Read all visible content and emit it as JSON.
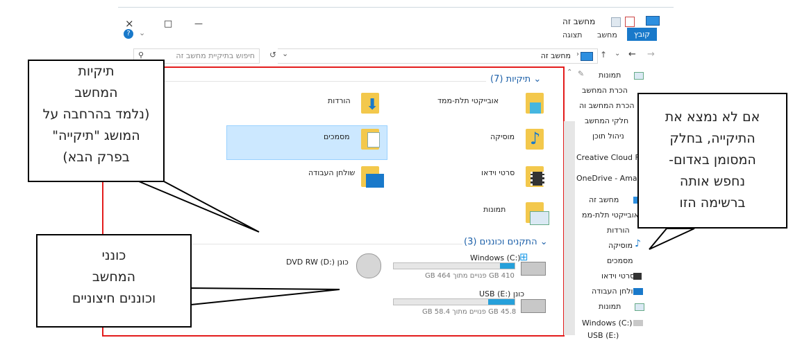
{
  "titlebar": {
    "title": "מחשב זה",
    "controls": {
      "close": "×",
      "maximize": "□",
      "minimize": "—"
    }
  },
  "ribbon": {
    "tabs": [
      "קובץ",
      "מחשב",
      "תצוגה"
    ]
  },
  "address": {
    "path": "מחשב זה",
    "search_placeholder": "חיפוש בתיקיית מחשב זה",
    "back": "←",
    "forward": "→",
    "up": "↑",
    "recent": "⌄",
    "refresh": "↺"
  },
  "folders": {
    "header": "תיקיות (7)",
    "items": [
      {
        "label": "אובייקטי תלת-ממד"
      },
      {
        "label": "הורדות"
      },
      {
        "label": "מוסיקה"
      },
      {
        "label": "מסמכים"
      },
      {
        "label": "סרטי וידאו"
      },
      {
        "label": "שולחן העבודה"
      },
      {
        "label": "תמונות"
      }
    ]
  },
  "drives": {
    "header": "התקנים וכוננים (3)",
    "items": [
      {
        "label": "Windows (C:)",
        "free": "410 GB פנויים מתוך 464 GB",
        "used_fraction": 0.12
      },
      {
        "label": "כונן DVD RW (D:)"
      },
      {
        "label": "כונן USB (E:)",
        "free": "45.8 GB פנויים מתוך 58.4 GB",
        "used_fraction": 0.22
      }
    ]
  },
  "nav_pane": {
    "items": [
      {
        "label": "תמונות"
      },
      {
        "label": "הכרת המחשב"
      },
      {
        "label": "הכרת המחשב וה"
      },
      {
        "label": "חלקי המחשב"
      },
      {
        "label": "ניהול תוכן"
      },
      {
        "label": "Creative Cloud Files"
      },
      {
        "label": "OneDrive - Amanet"
      },
      {
        "label": "מחשב זה"
      },
      {
        "label": "אובייקטי תלת-ממ"
      },
      {
        "label": "הורדות"
      },
      {
        "label": "מוסיקה"
      },
      {
        "label": "מסמכים"
      },
      {
        "label": "סרטי וידאו"
      },
      {
        "label": "שולחן העבודה"
      },
      {
        "label": "תמונות"
      },
      {
        "label": "Windows (C:)"
      },
      {
        "label": "USB (E:)"
      }
    ]
  },
  "callouts": {
    "folders_note": [
      "תיקיות",
      "המחשב",
      "(נלמד בהרחבה על",
      "המושג \"תיקייה\"",
      "בפרק הבא)"
    ],
    "drives_note": [
      "כונני",
      "המחשב",
      "וכוננים חיצוניים"
    ],
    "nav_note": [
      "אם לא נמצא את",
      "התיקייה, בחלק",
      "המסומן באדום-",
      "נחפש אותה",
      "ברשימה הזו"
    ]
  },
  "colors": {
    "accent": "#1979ca",
    "highlight": "#e31b1b",
    "selection": "#cce8ff",
    "drive_bar": "#26a0da"
  }
}
